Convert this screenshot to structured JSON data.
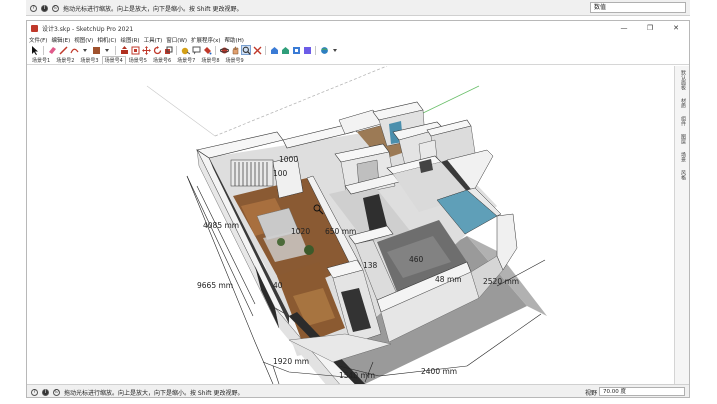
{
  "top_strip": {
    "hint": "拖动光标进行缩放。向上是放大，向下是缩小。按 Shift 更改视野。",
    "vcb_label": "数值"
  },
  "window": {
    "title": "设计3.skp - SketchUp Pro 2021",
    "controls": [
      "—",
      "❐",
      "✕"
    ]
  },
  "menu": [
    "文件(F)",
    "编辑(E)",
    "视图(V)",
    "相机(C)",
    "绘图(R)",
    "工具(T)",
    "窗口(W)",
    "扩展程序(x)",
    "帮助(H)"
  ],
  "scene_tabs": {
    "items": [
      "场景号1",
      "场景号2",
      "场景号3",
      "场景号4",
      "场景号5",
      "场景号6",
      "场景号7",
      "场景号8",
      "场景号9"
    ],
    "active_index": 3
  },
  "tray": [
    "默认面板",
    "材质",
    "组件",
    "图层",
    "场景",
    "风格"
  ],
  "dimensions": {
    "d4085": "4085 mm",
    "d9665": "9665 mm",
    "d1920": "1920 mm",
    "d1540": "1540 mm",
    "d2400": "2400 mm",
    "d2520": "2520 mm",
    "d1020": "1020",
    "d650": "650 mm",
    "d460": "460",
    "d138": "138",
    "d1000": "1000",
    "d100": "100",
    "d48": "48",
    "dmm": "mm",
    "d40": "40"
  },
  "status": {
    "hint": "拖动光标进行缩放。向上是放大，向下是缩小。按 Shift 更改视野。",
    "vcb_label": "视野",
    "vcb_value": "70.00 度"
  },
  "colors": {
    "wall_top": "#f4f4f4",
    "wall_side": "#dcdcdc",
    "wall_dark": "#3a3a3a",
    "wood_floor": "#8a5a33",
    "tile_floor": "#6e6e6e",
    "glass": "#5f9fb8",
    "shadow": "#9a9a9a"
  }
}
